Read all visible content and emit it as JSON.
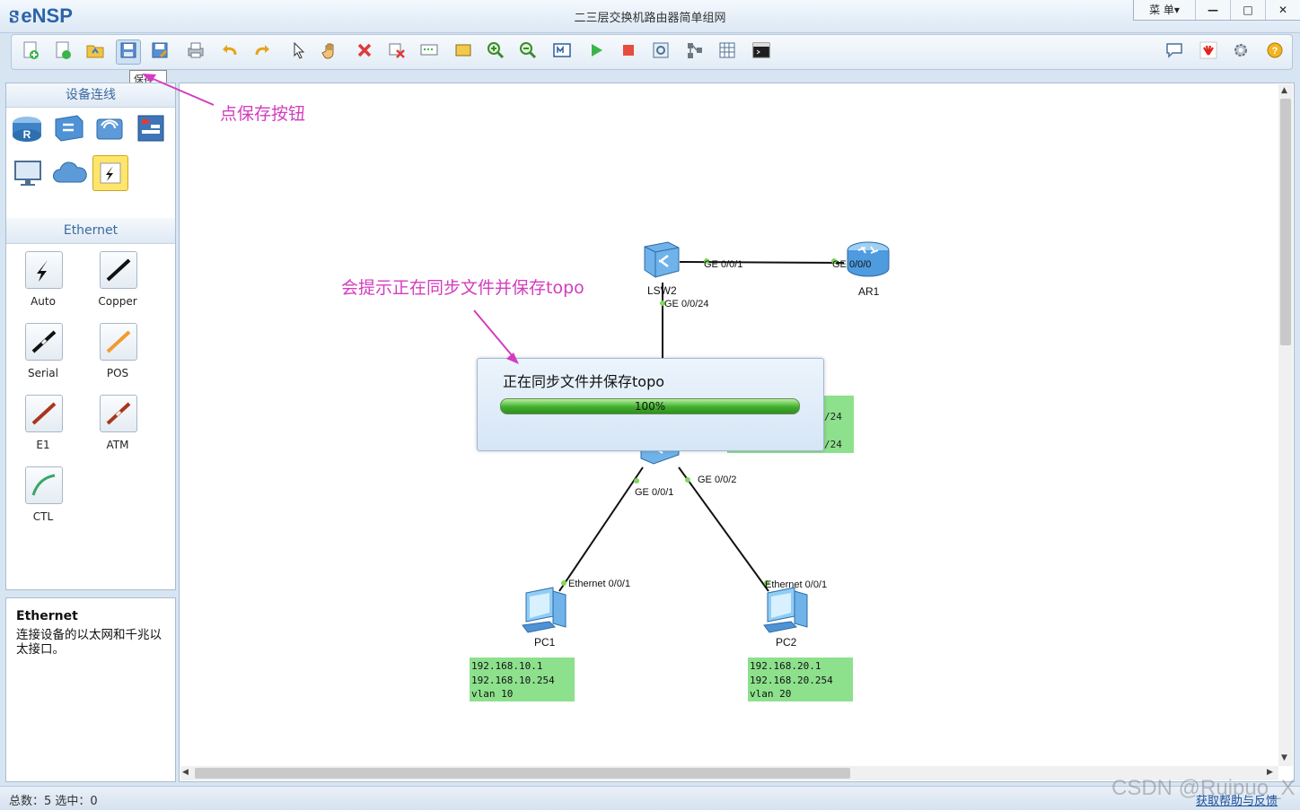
{
  "app": {
    "logo": "eNSP",
    "window_title": "二三层交换机路由器简单组网",
    "menu_label": "菜 单▾",
    "min": "—",
    "max": "□",
    "close": "✕"
  },
  "toolbar": {
    "tooltip": "保存"
  },
  "left_panel": {
    "devices_header": "设备连线",
    "ethernet_header": "Ethernet",
    "cables": [
      {
        "label": "Auto"
      },
      {
        "label": "Copper"
      },
      {
        "label": "Serial"
      },
      {
        "label": "POS"
      },
      {
        "label": "E1"
      },
      {
        "label": "ATM"
      },
      {
        "label": "CTL"
      }
    ],
    "desc_title": "Ethernet",
    "desc_text": "连接设备的以太网和千兆以太接口。"
  },
  "topology": {
    "devices": {
      "lsw2": "LSW2",
      "ar1": "AR1",
      "pc1": "PC1",
      "pc2": "PC2"
    },
    "ports": {
      "lsw2_ar1": "GE 0/0/1",
      "ar1_lsw2": "GE 0/0/0",
      "lsw2_down": "GE 0/0/24",
      "lsw_pc1": "GE 0/0/1",
      "lsw_pc2": "GE 0/0/2",
      "pc1_eth": "Ethernet 0/0/1",
      "pc2_eth": "Ethernet 0/0/1"
    },
    "pc1_info": "192.168.10.1\n192.168.10.254\nvlan 10",
    "pc2_info": "192.168.20.1\n192.168.20.254\nvlan 20",
    "hidden_box_line1": "/24",
    "hidden_box_line2": "/24"
  },
  "dialog": {
    "message": "正在同步文件并保存topo",
    "progress_text": "100%",
    "progress": 1.0
  },
  "annotations": {
    "save_hint": "点保存按钮",
    "sync_hint": "会提示正在同步文件并保存topo"
  },
  "status": {
    "total": "总数：5 选中：0",
    "help": "获取帮助与反馈",
    "watermark": "CSDN @Ruipuo_X"
  }
}
